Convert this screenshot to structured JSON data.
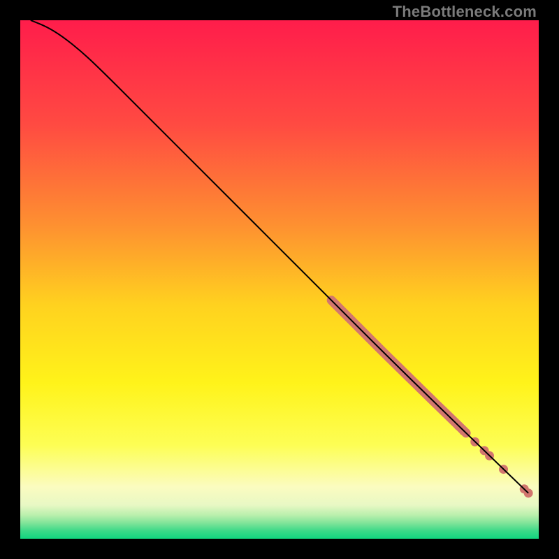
{
  "watermark": "TheBottleneck.com",
  "chart_data": {
    "type": "line",
    "title": "",
    "xlabel": "",
    "ylabel": "",
    "xlim": [
      0,
      100
    ],
    "ylim": [
      0,
      100
    ],
    "gradient_stops": [
      {
        "offset": 0.0,
        "color": "#ff1d4b"
      },
      {
        "offset": 0.2,
        "color": "#ff4a42"
      },
      {
        "offset": 0.4,
        "color": "#fe9230"
      },
      {
        "offset": 0.55,
        "color": "#ffd21f"
      },
      {
        "offset": 0.7,
        "color": "#fff31a"
      },
      {
        "offset": 0.82,
        "color": "#fdfe55"
      },
      {
        "offset": 0.9,
        "color": "#fbfcc0"
      },
      {
        "offset": 0.935,
        "color": "#e8f8c4"
      },
      {
        "offset": 0.955,
        "color": "#b8efac"
      },
      {
        "offset": 0.97,
        "color": "#7fe499"
      },
      {
        "offset": 0.985,
        "color": "#3bd988"
      },
      {
        "offset": 1.0,
        "color": "#11d57f"
      }
    ],
    "curve": [
      {
        "x": 2.0,
        "y": 100.0
      },
      {
        "x": 5.0,
        "y": 98.8
      },
      {
        "x": 8.0,
        "y": 97.0
      },
      {
        "x": 12.0,
        "y": 93.8
      },
      {
        "x": 16.0,
        "y": 90.0
      },
      {
        "x": 22.0,
        "y": 84.0
      },
      {
        "x": 30.0,
        "y": 76.0
      },
      {
        "x": 40.0,
        "y": 66.0
      },
      {
        "x": 50.0,
        "y": 56.0
      },
      {
        "x": 60.0,
        "y": 46.0
      },
      {
        "x": 70.0,
        "y": 36.0
      },
      {
        "x": 80.0,
        "y": 26.2
      },
      {
        "x": 90.0,
        "y": 16.5
      },
      {
        "x": 98.0,
        "y": 8.8
      }
    ],
    "curve_highlight_range": {
      "x_start": 60.0,
      "x_end": 86.0
    },
    "scatter": [
      {
        "x": 84.5,
        "y": 21.8
      },
      {
        "x": 85.5,
        "y": 20.8
      },
      {
        "x": 87.7,
        "y": 18.7
      },
      {
        "x": 89.5,
        "y": 17.0
      },
      {
        "x": 90.5,
        "y": 16.0
      },
      {
        "x": 93.2,
        "y": 13.4
      },
      {
        "x": 97.2,
        "y": 9.6
      },
      {
        "x": 98.0,
        "y": 8.8
      }
    ],
    "scatter_color": "#d2766e",
    "line_color": "#000000"
  }
}
